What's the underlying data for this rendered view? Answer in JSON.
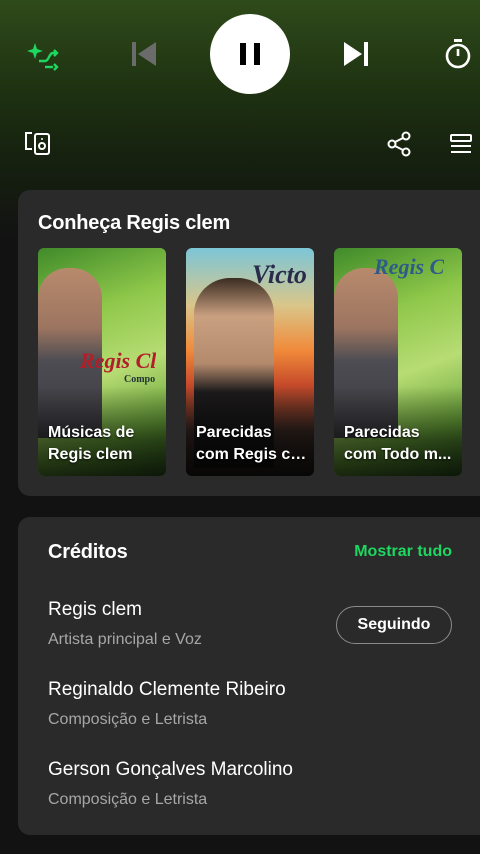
{
  "player": {
    "shuffle_icon": "smart-shuffle-icon",
    "prev_icon": "skip-previous-icon",
    "play_state_icon": "pause-icon",
    "next_icon": "skip-next-icon",
    "timer_icon": "sleep-timer-icon",
    "accent": "#1ed760"
  },
  "toolbar": {
    "devices_icon": "connect-devices-icon",
    "share_icon": "share-icon",
    "queue_icon": "queue-icon"
  },
  "discover": {
    "title": "Conheça Regis clem",
    "tiles": [
      {
        "line1": "Músicas de",
        "line2": "Regis clem",
        "cover_text": "Regis Cl",
        "cover_sub": "Compo"
      },
      {
        "line1": "Parecidas",
        "line2": "com Regis cl...",
        "cover_text": "Victo"
      },
      {
        "line1": "Parecidas",
        "line2": "com Todo m...",
        "cover_text": "Regis C"
      }
    ]
  },
  "credits": {
    "title": "Créditos",
    "show_all": "Mostrar tudo",
    "follow_label": "Seguindo",
    "people": [
      {
        "name": "Regis clem",
        "role": "Artista principal e Voz"
      },
      {
        "name": "Reginaldo Clemente Ribeiro",
        "role": "Composição e Letrista"
      },
      {
        "name": "Gerson Gonçalves Marcolino",
        "role": "Composição e Letrista"
      }
    ]
  }
}
